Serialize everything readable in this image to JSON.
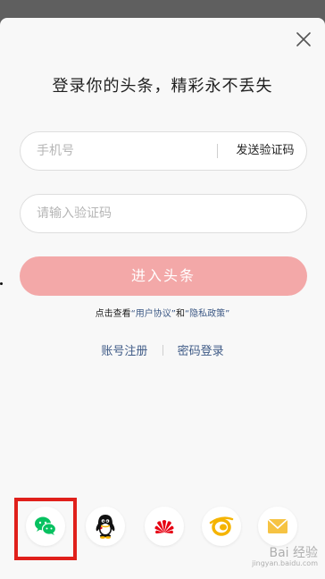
{
  "dialog": {
    "title": "登录你的头条，精彩永不丢失"
  },
  "phone_field": {
    "placeholder": "手机号",
    "value": "",
    "send_code_label": "发送验证码"
  },
  "code_field": {
    "placeholder": "请输入验证码",
    "value": ""
  },
  "submit_label": "进入头条",
  "agreement": {
    "prefix": "点击查看",
    "terms_label": "“用户协议”",
    "middle": "和",
    "privacy_label": "“隐私政策”"
  },
  "links": {
    "register_label": "账号注册",
    "password_login_label": "密码登录"
  },
  "social_logins": [
    {
      "icon": "wechat-icon",
      "color": "#07c160"
    },
    {
      "icon": "qq-icon",
      "color": "#111111"
    },
    {
      "icon": "huawei-icon",
      "color": "#e60012"
    },
    {
      "icon": "tianyi-icon",
      "color": "#f5b400"
    },
    {
      "icon": "mail-icon",
      "color": "#f6c343"
    }
  ],
  "watermark": {
    "text": "Bai 经验",
    "subtext": "jingyan.baidu.com"
  }
}
